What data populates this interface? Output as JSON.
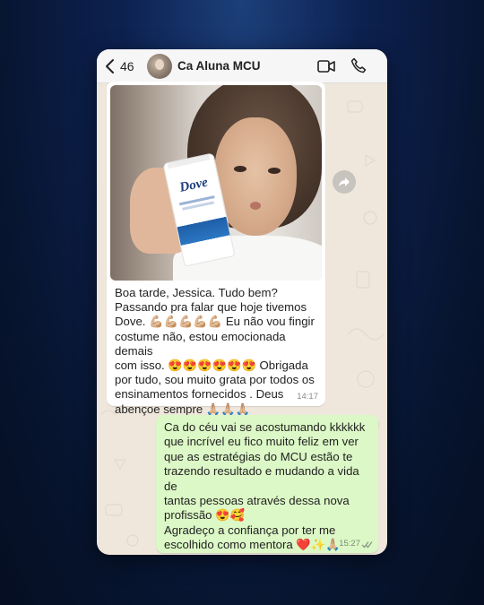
{
  "header": {
    "back_count": "46",
    "contact_name": "Ca Aluna MCU",
    "icons": {
      "back": "chevron-left-icon",
      "video": "video-call-icon",
      "call": "phone-call-icon"
    }
  },
  "incoming": {
    "media": {
      "type": "photo",
      "product_label": "Dove"
    },
    "text": "Boa tarde, Jessica. Tudo bem?\nPassando pra falar que hoje tivemos\nDove. 💪🏼💪🏼💪🏼💪🏼💪🏼 Eu não vou fingir\ncostume não, estou emocionada demais\ncom isso. 😍😍😍😍😍😍 Obrigada\npor tudo, sou muito grata por todos os\nensinamentos fornecidos . Deus\nabençoe sempre 🙏🏼🙏🏼🙏🏼",
    "time": "14:17"
  },
  "outgoing": {
    "text": "Ca do céu vai se acostumando kkkkkk\nque incrível eu fico muito feliz em ver\nque as estratégias do MCU estão te\ntrazendo resultado e mudando a vida de\ntantas pessoas através dessa nova\nprofissão 😍🥰\nAgradeço a confiança por ter me\nescolhido como mentora ❤️✨🙏🏼",
    "time": "15:27",
    "status": "read"
  },
  "colors": {
    "chat_background": "#efe7dc",
    "incoming_bubble": "#ffffff",
    "outgoing_bubble": "#dcf8c6",
    "page_background": "#0d2150"
  }
}
